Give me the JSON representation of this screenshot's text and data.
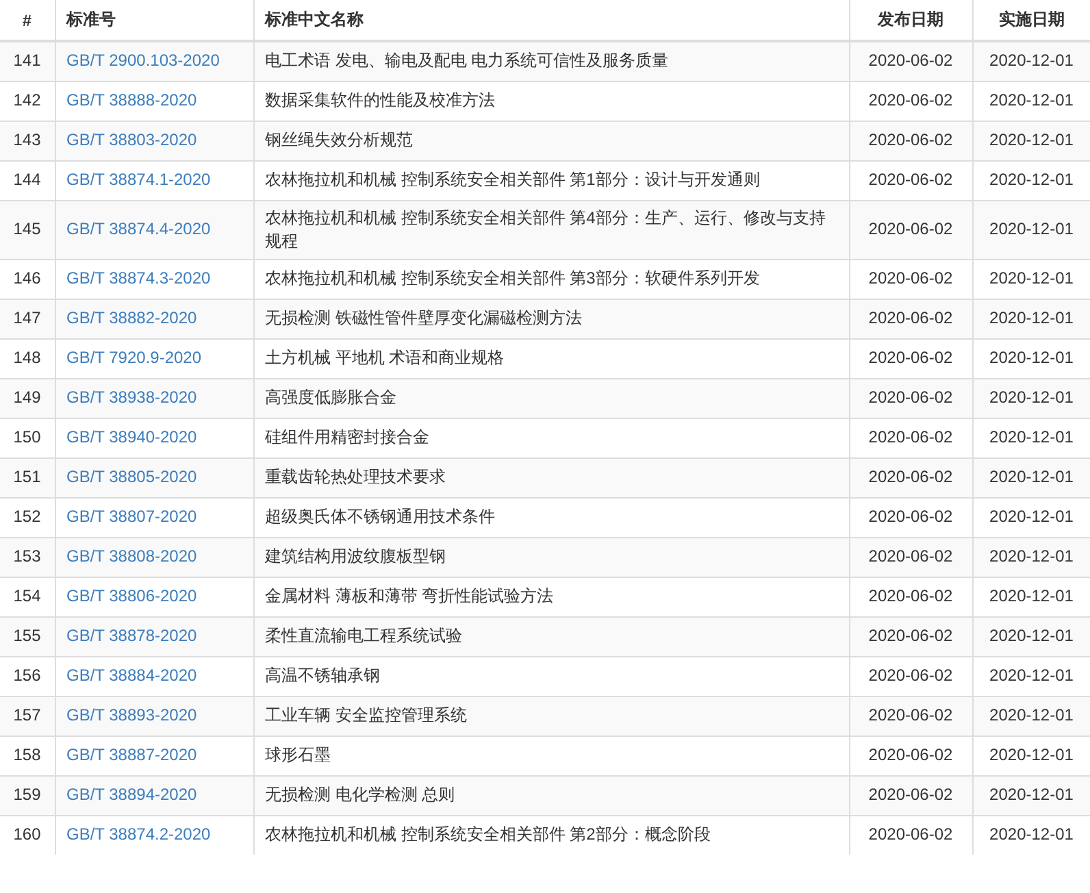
{
  "table": {
    "columns": [
      "#",
      "标准号",
      "标准中文名称",
      "发布日期",
      "实施日期"
    ],
    "rows": [
      {
        "index": "141",
        "code": "GB/T 2900.103-2020",
        "name": "电工术语 发电、输电及配电 电力系统可信性及服务质量",
        "published": "2020-06-02",
        "effective": "2020-12-01"
      },
      {
        "index": "142",
        "code": "GB/T 38888-2020",
        "name": "数据采集软件的性能及校准方法",
        "published": "2020-06-02",
        "effective": "2020-12-01"
      },
      {
        "index": "143",
        "code": "GB/T 38803-2020",
        "name": "钢丝绳失效分析规范",
        "published": "2020-06-02",
        "effective": "2020-12-01"
      },
      {
        "index": "144",
        "code": "GB/T 38874.1-2020",
        "name": "农林拖拉机和机械 控制系统安全相关部件 第1部分：设计与开发通则",
        "published": "2020-06-02",
        "effective": "2020-12-01"
      },
      {
        "index": "145",
        "code": "GB/T 38874.4-2020",
        "name": "农林拖拉机和机械 控制系统安全相关部件 第4部分：生产、运行、修改与支持规程",
        "published": "2020-06-02",
        "effective": "2020-12-01"
      },
      {
        "index": "146",
        "code": "GB/T 38874.3-2020",
        "name": "农林拖拉机和机械 控制系统安全相关部件 第3部分：软硬件系列开发",
        "published": "2020-06-02",
        "effective": "2020-12-01"
      },
      {
        "index": "147",
        "code": "GB/T 38882-2020",
        "name": "无损检测 铁磁性管件壁厚变化漏磁检测方法",
        "published": "2020-06-02",
        "effective": "2020-12-01"
      },
      {
        "index": "148",
        "code": "GB/T 7920.9-2020",
        "name": "土方机械 平地机 术语和商业规格",
        "published": "2020-06-02",
        "effective": "2020-12-01"
      },
      {
        "index": "149",
        "code": "GB/T 38938-2020",
        "name": "高强度低膨胀合金",
        "published": "2020-06-02",
        "effective": "2020-12-01"
      },
      {
        "index": "150",
        "code": "GB/T 38940-2020",
        "name": "硅组件用精密封接合金",
        "published": "2020-06-02",
        "effective": "2020-12-01"
      },
      {
        "index": "151",
        "code": "GB/T 38805-2020",
        "name": "重载齿轮热处理技术要求",
        "published": "2020-06-02",
        "effective": "2020-12-01"
      },
      {
        "index": "152",
        "code": "GB/T 38807-2020",
        "name": "超级奥氏体不锈钢通用技术条件",
        "published": "2020-06-02",
        "effective": "2020-12-01"
      },
      {
        "index": "153",
        "code": "GB/T 38808-2020",
        "name": "建筑结构用波纹腹板型钢",
        "published": "2020-06-02",
        "effective": "2020-12-01"
      },
      {
        "index": "154",
        "code": "GB/T 38806-2020",
        "name": "金属材料 薄板和薄带 弯折性能试验方法",
        "published": "2020-06-02",
        "effective": "2020-12-01"
      },
      {
        "index": "155",
        "code": "GB/T 38878-2020",
        "name": "柔性直流输电工程系统试验",
        "published": "2020-06-02",
        "effective": "2020-12-01"
      },
      {
        "index": "156",
        "code": "GB/T 38884-2020",
        "name": "高温不锈轴承钢",
        "published": "2020-06-02",
        "effective": "2020-12-01"
      },
      {
        "index": "157",
        "code": "GB/T 38893-2020",
        "name": "工业车辆 安全监控管理系统",
        "published": "2020-06-02",
        "effective": "2020-12-01"
      },
      {
        "index": "158",
        "code": "GB/T 38887-2020",
        "name": "球形石墨",
        "published": "2020-06-02",
        "effective": "2020-12-01"
      },
      {
        "index": "159",
        "code": "GB/T 38894-2020",
        "name": "无损检测 电化学检测 总则",
        "published": "2020-06-02",
        "effective": "2020-12-01"
      },
      {
        "index": "160",
        "code": "GB/T 38874.2-2020",
        "name": "农林拖拉机和机械 控制系统安全相关部件 第2部分：概念阶段",
        "published": "2020-06-02",
        "effective": "2020-12-01"
      }
    ]
  }
}
